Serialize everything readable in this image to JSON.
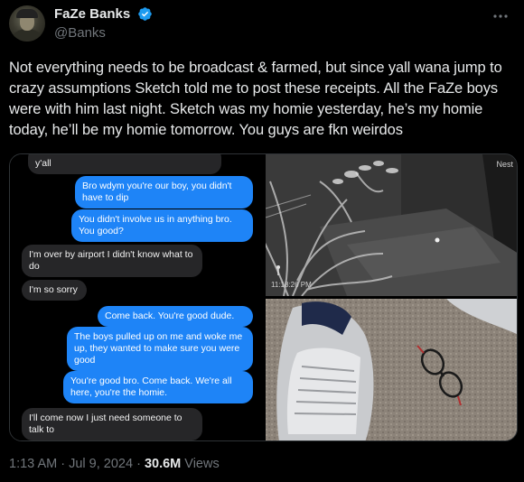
{
  "author": {
    "display_name": "FaZe Banks",
    "handle": "@Banks"
  },
  "tweet": {
    "text": "Not everything needs to be broadcast & farmed, but since yall wana jump to crazy assumptions Sketch told me to post these receipts. All the FaZe boys were with him last night. Sketch was my homie yesterday, he’s my homie today, he’ll be my homie tomorrow. You guys are fkn weirdos"
  },
  "messages": [
    {
      "from": "them",
      "text": "y'all"
    },
    {
      "from": "me",
      "text": "Bro wdym you're our boy, you didn't have to dip"
    },
    {
      "from": "me",
      "text": "You didn't involve us in anything bro. You good?"
    },
    {
      "from": "them",
      "text": "I'm over by airport I didn't know what to do"
    },
    {
      "from": "them",
      "text": "I'm so sorry"
    },
    {
      "from": "me",
      "text": "Come back. You're good dude."
    },
    {
      "from": "me",
      "text": "The boys pulled up on me and woke me up, they wanted to make sure you were good"
    },
    {
      "from": "me",
      "text": "You're good bro. Come back. We're all here, you're the homie."
    },
    {
      "from": "them",
      "text": "I'll come now I just need someone to talk to"
    }
  ],
  "camera": {
    "label": "Nest",
    "timestamp": "11:18:26 PM"
  },
  "meta": {
    "time": "1:13 AM",
    "sep1": " · ",
    "date": "Jul 9, 2024",
    "sep2": " · ",
    "views_count": "30.6M",
    "views_label": " Views"
  },
  "colors": {
    "background": "#000000",
    "text": "#e7e9ea",
    "secondary_text": "#71767b",
    "verified": "#1d9bf0",
    "imessage_blue": "#1e84f7",
    "imessage_gray": "#262628"
  },
  "icons": [
    "verified-badge-icon",
    "more-options-icon",
    "person-motion-icon"
  ]
}
